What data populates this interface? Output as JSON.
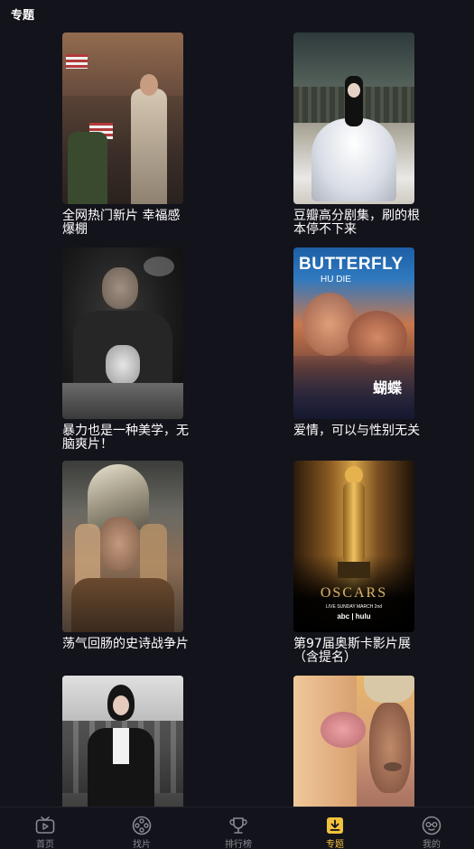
{
  "header": {
    "title": "专题"
  },
  "cards": [
    {
      "title": "全网热门新片 幸福感爆棚"
    },
    {
      "title": "豆瓣高分剧集，刷的根本停不下来"
    },
    {
      "title": "暴力也是一种美学，无脑爽片！"
    },
    {
      "title": "爱情，可以与性别无关",
      "poster_text": {
        "title": "BUTTERFLY",
        "subtitle": "HU DIE",
        "cn": "蝴蝶"
      }
    },
    {
      "title": "荡气回肠的史诗战争片"
    },
    {
      "title": "第97届奥斯卡影片展（含提名）",
      "poster_text": {
        "word": "OSCARS",
        "live": "LIVE SUNDAY MARCH 2nd",
        "brands": "abc | hulu"
      }
    },
    {
      "title": ""
    },
    {
      "title": ""
    }
  ],
  "tabbar": {
    "active_color": "#f2c23e",
    "items": [
      {
        "label": "首页",
        "icon": "tv-icon"
      },
      {
        "label": "找片",
        "icon": "film-reel-icon"
      },
      {
        "label": "排行榜",
        "icon": "trophy-icon"
      },
      {
        "label": "专题",
        "icon": "download-box-icon",
        "active": true
      },
      {
        "label": "我的",
        "icon": "glasses-face-icon"
      }
    ]
  }
}
